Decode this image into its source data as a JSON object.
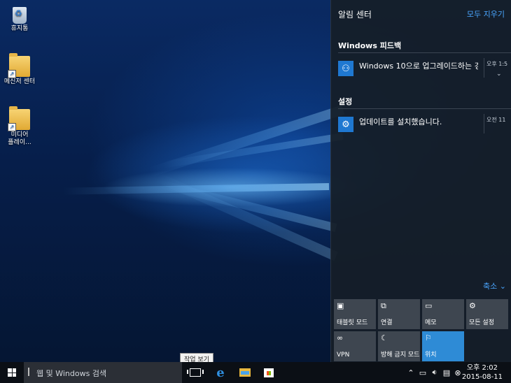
{
  "desktop": {
    "icons": [
      {
        "label": "휴지통"
      },
      {
        "label": "메신저 센터"
      },
      {
        "label_line1": "미디어",
        "label_line2": "플레이..."
      }
    ]
  },
  "action_center": {
    "title": "알림 센터",
    "clear_all": "모두 지우기",
    "groups": [
      {
        "title": "Windows 피드백",
        "notification": {
          "icon": "feedback-icon",
          "text": "Windows 10으로 업그레이드하는 경",
          "time": "오후 1:5",
          "expand": "⌄"
        }
      },
      {
        "title": "설정",
        "notification": {
          "icon": "gear-icon",
          "text": "업데이트를 설치했습니다.",
          "time": "오전 11"
        }
      }
    ],
    "collapse": "축소 ⌄",
    "quick_actions": [
      {
        "label": "태블릿 모드",
        "icon": "tablet-mode-icon",
        "active": false
      },
      {
        "label": "연결",
        "icon": "connect-icon",
        "active": false
      },
      {
        "label": "메모",
        "icon": "note-icon",
        "active": false
      },
      {
        "label": "모든 설정",
        "icon": "settings-icon",
        "active": false
      },
      {
        "label": "VPN",
        "icon": "vpn-icon",
        "active": false
      },
      {
        "label": "방해 금지 모드",
        "icon": "moon-icon",
        "active": false
      },
      {
        "label": "위치",
        "icon": "location-icon",
        "active": true
      }
    ]
  },
  "taskbar": {
    "search_placeholder": "웹 및 Windows 검색",
    "tooltip": "작업 보기",
    "clock_time": "오후 2:02",
    "clock_date": "2015-08-11"
  },
  "colors": {
    "accent": "#2e8bd6",
    "link": "#4aa6ff",
    "taskbar": "#0b0f15"
  }
}
